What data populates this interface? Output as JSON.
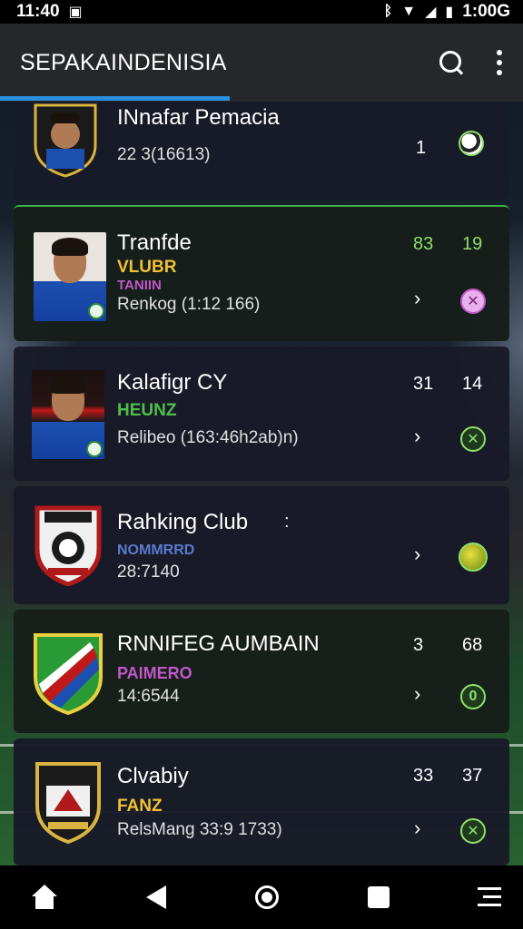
{
  "status_bar": {
    "time": "11:40",
    "battery_text": "1:00G",
    "icons": [
      "notification-icon",
      "vibrate-icon",
      "wifi-icon",
      "signal-icon",
      "battery-icon"
    ]
  },
  "app_bar": {
    "title": "SEPAKAINDENISIA"
  },
  "colors": {
    "accent": "#2b8fe0",
    "green": "#8ee06a",
    "yellow": "#f1c232",
    "purple": "#c058c8",
    "blue_sub": "#5a7ad0"
  },
  "cards": [
    {
      "name": "INnafar Pemacia",
      "sub": "",
      "sub2": "",
      "meta": "22 3(16613)",
      "stat1": "1",
      "stat2": "",
      "action_icon": "soccer-ball-icon"
    },
    {
      "name": "Tranfde",
      "sub": "VLUBR",
      "sub2": "TANIIN",
      "meta": "Renkog (1:12 166)",
      "stat1": "83",
      "stat2": "19",
      "action_icon": "close-circle-icon"
    },
    {
      "name": "Kalafigr CY",
      "sub": "HEUNZ",
      "sub2": "",
      "meta": "Relibeo (163:46h2ab)n)",
      "stat1": "31",
      "stat2": "14",
      "action_icon": "close-circle-icon"
    },
    {
      "name": "Rahking Club",
      "sub": "NOMMRRD",
      "sub2": "",
      "meta": "28:7140",
      "stat1": ":",
      "stat2": "",
      "action_icon": "ball-icon"
    },
    {
      "name": "RNNIFEG AUMBAIN",
      "sub": "PAIMERO",
      "sub2": "",
      "meta": "14:6544",
      "stat1": "3",
      "stat2": "68",
      "action_icon": "circle-icon"
    },
    {
      "name": "Clvabiy",
      "sub": "FANZ",
      "sub2": "",
      "meta": "RelsMang 33:9 1733)",
      "stat1": "33",
      "stat2": "37",
      "action_icon": "close-circle-icon"
    }
  ],
  "nav_bar": {
    "buttons": [
      "home-icon",
      "back-icon",
      "home-circle-icon",
      "recents-icon",
      "menu-icon"
    ]
  }
}
